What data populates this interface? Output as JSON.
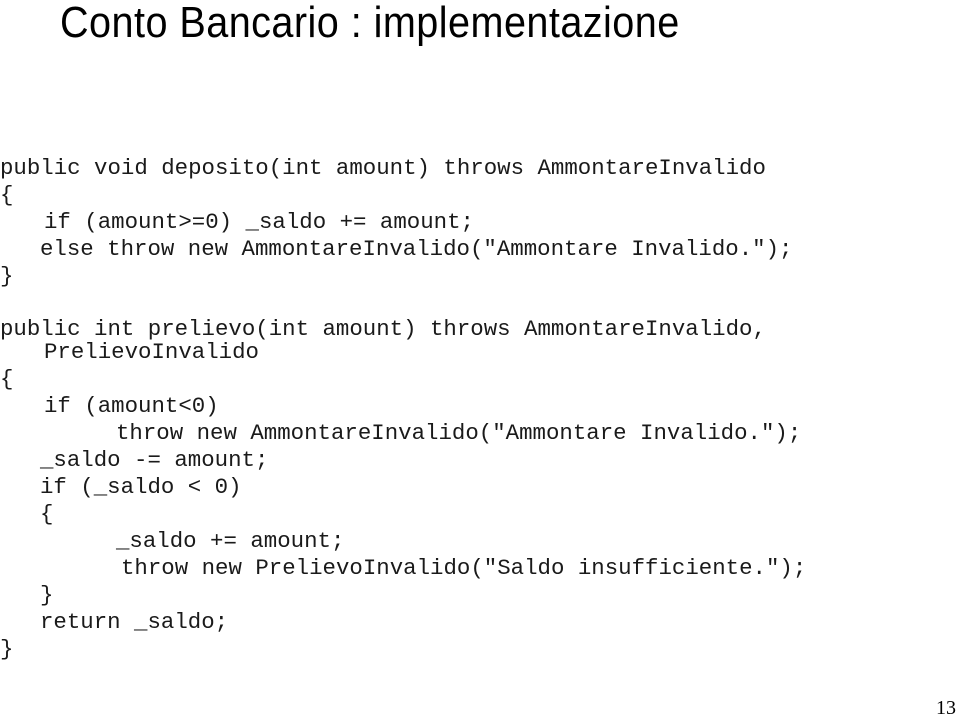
{
  "slide": {
    "title": "Conto Bancario : implementazione",
    "page_number": "13"
  },
  "code": {
    "deposito": {
      "signature": "public void deposito(int amount) throws AmmontareInvalido",
      "open_brace": "{",
      "line_if": "if (amount>=0) _saldo += amount;",
      "line_else": "else throw new AmmontareInvalido(\"Ammontare Invalido.\");",
      "close_brace": "}"
    },
    "prelievo": {
      "signature": "public int prelievo(int amount) throws AmmontareInvalido,",
      "signature_cont": "PrelievoInvalido",
      "open_brace": "{",
      "line_if_amount": "if (amount<0)",
      "line_throw_ammontare": "throw new AmmontareInvalido(\"Ammontare Invalido.\");",
      "line_subtract": "_saldo -= amount;",
      "line_if_saldo": "if (_saldo < 0)",
      "inner_open_brace": "{",
      "line_add_back": "_saldo += amount;",
      "line_throw_prelievo": "throw new PrelievoInvalido(\"Saldo insufficiente.\");",
      "inner_close_brace": "}",
      "line_return": "return _saldo;",
      "close_brace": "}"
    }
  }
}
